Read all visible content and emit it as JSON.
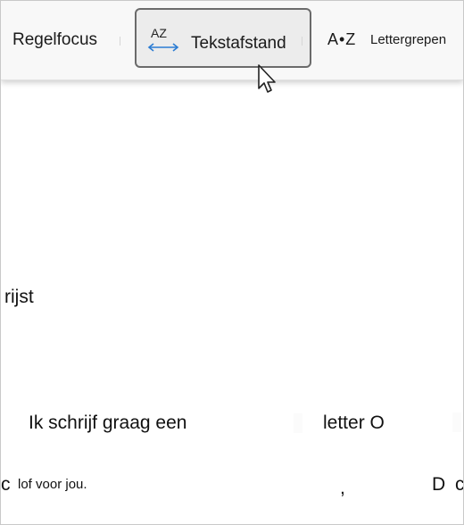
{
  "toolbar": {
    "items": [
      {
        "label": "Regelfocus",
        "icon": "line-focus-icon"
      },
      {
        "label": "Tekstafstand",
        "icon_text": "AZ",
        "icon": "text-spacing-icon",
        "selected": true
      },
      {
        "label": "Lettergrepen",
        "icon_text": "A•Z",
        "icon": "syllables-icon"
      }
    ]
  },
  "document": {
    "line1_fragment": "rijst",
    "line2_left": "Ik schrijf graag een",
    "line2_right": "letter O",
    "line3_c": "c",
    "line3_left": "lof voor jou.",
    "line3_comma": ",",
    "line3_d": "D",
    "line3_c2": "c"
  },
  "colors": {
    "toolbar_bg": "#f8f8f8",
    "selected_bg": "#ececec",
    "selected_border": "#6b6b6b",
    "icon_arrow": "#2b7cd3"
  }
}
